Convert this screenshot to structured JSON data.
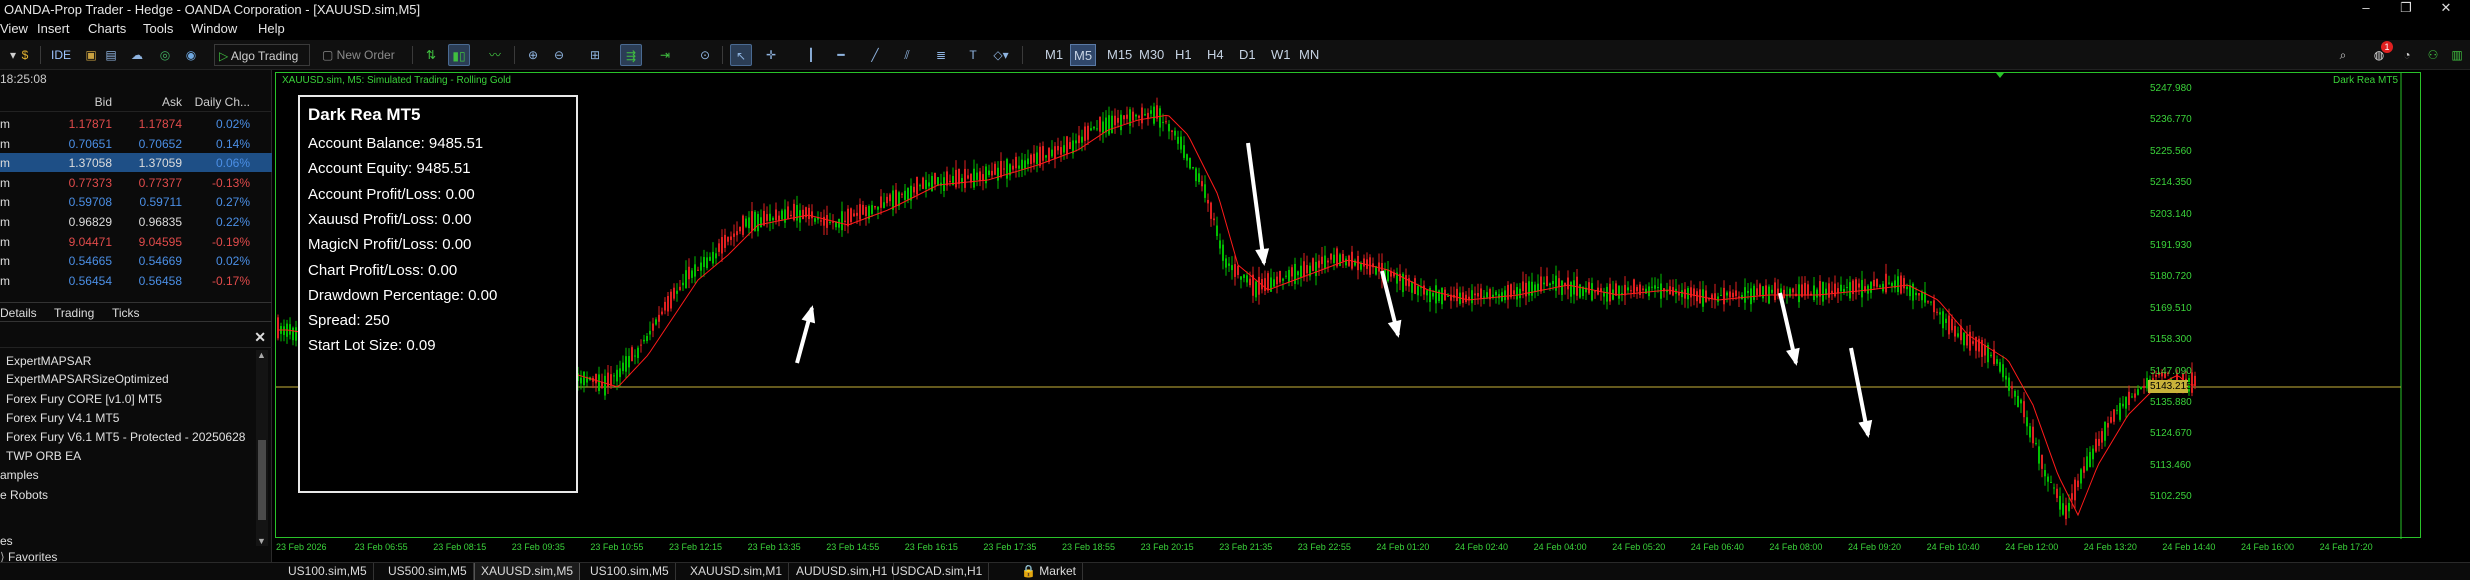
{
  "window": {
    "title": "OANDA-Prop Trader - Hedge - OANDA Corporation - [XAUUSD.sim,M5]",
    "controls": [
      "–",
      "❐",
      "✕"
    ]
  },
  "menu": [
    "View",
    "Insert",
    "Charts",
    "Tools",
    "Window",
    "Help"
  ],
  "toolbar": {
    "ide_label": "IDE",
    "algo_trading_label": "Algo Trading",
    "new_order_label": "New Order",
    "timeframes": [
      "M1",
      "M5",
      "M15",
      "M30",
      "H1",
      "H4",
      "D1",
      "W1",
      "MN"
    ],
    "active_timeframe": "M5",
    "notification_count": "1"
  },
  "market_watch": {
    "time": "18:25:08",
    "columns": [
      "Bid",
      "Ask",
      "Daily Ch..."
    ],
    "rows": [
      {
        "symbol": "m",
        "bid": "1.17871",
        "ask": "1.17874",
        "change": "0.02%",
        "dir": "down",
        "cdir": "up"
      },
      {
        "symbol": "m",
        "bid": "0.70651",
        "ask": "0.70652",
        "change": "0.14%",
        "dir": "up",
        "cdir": "up"
      },
      {
        "symbol": "m",
        "bid": "1.37058",
        "ask": "1.37059",
        "change": "0.06%",
        "dir": "neutral",
        "cdir": "up",
        "selected": true
      },
      {
        "symbol": "m",
        "bid": "0.77373",
        "ask": "0.77377",
        "change": "-0.13%",
        "dir": "down",
        "cdir": "down"
      },
      {
        "symbol": "m",
        "bid": "0.59708",
        "ask": "0.59711",
        "change": "0.27%",
        "dir": "up",
        "cdir": "up"
      },
      {
        "symbol": "m",
        "bid": "0.96829",
        "ask": "0.96835",
        "change": "0.22%",
        "dir": "neutral",
        "cdir": "up"
      },
      {
        "symbol": "m",
        "bid": "9.04471",
        "ask": "9.04595",
        "change": "-0.19%",
        "dir": "down",
        "cdir": "down"
      },
      {
        "symbol": "m",
        "bid": "0.54665",
        "ask": "0.54669",
        "change": "0.02%",
        "dir": "up",
        "cdir": "up"
      },
      {
        "symbol": "m",
        "bid": "0.56454",
        "ask": "0.56458",
        "change": "-0.17%",
        "dir": "up",
        "cdir": "down"
      }
    ],
    "tabs": [
      "Details",
      "Trading",
      "Ticks"
    ]
  },
  "navigator": {
    "items": [
      "ExpertMAPSAR",
      "ExpertMAPSARSizeOptimized",
      "Forex Fury CORE [v1.0] MT5",
      "Forex Fury V4.1 MT5",
      "Forex Fury V6.1 MT5 - Protected - 20250628",
      "TWP ORB EA",
      "amples",
      "e Robots",
      "es"
    ],
    "favorites_label": "Favorites"
  },
  "chart": {
    "title": "XAUUSD.sim, M5:  Simulated Trading - Rolling Gold",
    "ea_name": "Dark Rea MT5",
    "price_labels": [
      "5247.980",
      "5236.770",
      "5225.560",
      "5214.350",
      "5203.140",
      "5191.930",
      "5180.720",
      "5169.510",
      "5158.300",
      "5147.090",
      "5135.880",
      "5124.670",
      "5113.460",
      "5102.250"
    ],
    "current_price": "5143.215",
    "time_labels": [
      "23 Feb 2026",
      "23 Feb 06:55",
      "23 Feb 08:15",
      "23 Feb 09:35",
      "23 Feb 10:55",
      "23 Feb 12:15",
      "23 Feb 13:35",
      "23 Feb 14:55",
      "23 Feb 16:15",
      "23 Feb 17:35",
      "23 Feb 18:55",
      "23 Feb 20:15",
      "23 Feb 21:35",
      "23 Feb 22:55",
      "24 Feb 01:20",
      "24 Feb 02:40",
      "24 Feb 04:00",
      "24 Feb 05:20",
      "24 Feb 06:40",
      "24 Feb 08:00",
      "24 Feb 09:20",
      "24 Feb 10:40",
      "24 Feb 12:00",
      "24 Feb 13:20",
      "24 Feb 14:40",
      "24 Feb 16:00",
      "24 Feb 17:20"
    ],
    "colors": {
      "bull": "#00c000",
      "bear": "#e02020",
      "ma": "#ff1a1a",
      "grid": "#29c229",
      "price_line": "#c9b23a",
      "arrow": "#ffffff"
    }
  },
  "info_panel": {
    "title": "Dark Rea MT5",
    "lines": [
      "Account Balance: 9485.51",
      "Account Equity: 9485.51",
      "Account Profit/Loss: 0.00",
      "Xauusd Profit/Loss: 0.00",
      "MagicN Profit/Loss: 0.00",
      "Chart Profit/Loss: 0.00",
      "Drawdown Percentage: 0.00",
      "Spread: 250",
      "Start Lot Size: 0.09"
    ]
  },
  "bottom_tabs": [
    "US100.sim,M5",
    "US500.sim,M5",
    "XAUUSD.sim,M5",
    "US100.sim,M5",
    "XAUUSD.sim,M1",
    "AUDUSD.sim,H1",
    "USDCAD.sim,H1",
    "Market"
  ],
  "active_bottom_tab": 2
}
